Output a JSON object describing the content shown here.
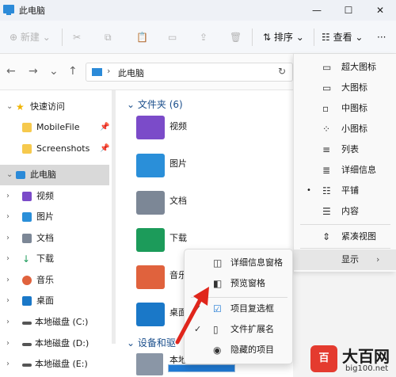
{
  "window": {
    "title": "此电脑"
  },
  "toolbar": {
    "new_label": "新建",
    "sort_label": "排序",
    "view_label": "查看",
    "more_label": "···"
  },
  "address": {
    "crumb": "此电脑"
  },
  "sidebar": {
    "items": [
      {
        "label": "快速访问"
      },
      {
        "label": "MobileFile"
      },
      {
        "label": "Screenshots"
      },
      {
        "label": "此电脑"
      },
      {
        "label": "视频"
      },
      {
        "label": "图片"
      },
      {
        "label": "文档"
      },
      {
        "label": "下载"
      },
      {
        "label": "音乐"
      },
      {
        "label": "桌面"
      },
      {
        "label": "本地磁盘 (C:)"
      },
      {
        "label": "本地磁盘 (D:)"
      },
      {
        "label": "本地磁盘 (E:)"
      }
    ]
  },
  "content": {
    "folders_group": "文件夹 (6)",
    "devices_group": "设备和驱",
    "folders": [
      "视频",
      "图片",
      "文档",
      "下载",
      "音乐",
      "桌面"
    ],
    "drive_label": "本地"
  },
  "view_menu": {
    "items": [
      "超大图标",
      "大图标",
      "中图标",
      "小图标",
      "列表",
      "详细信息",
      "平铺",
      "内容",
      "紧凑视图",
      "显示"
    ]
  },
  "show_submenu": {
    "items": [
      "详细信息窗格",
      "预览窗格",
      "项目复选框",
      "文件扩展名",
      "隐藏的项目"
    ]
  },
  "watermark": {
    "name": "大百网",
    "url": "big100.net",
    "logo_text": "百"
  },
  "colors": {
    "accent": "#1f7ad4",
    "selected": "#d9d9d9",
    "arrow": "#e0261c"
  }
}
